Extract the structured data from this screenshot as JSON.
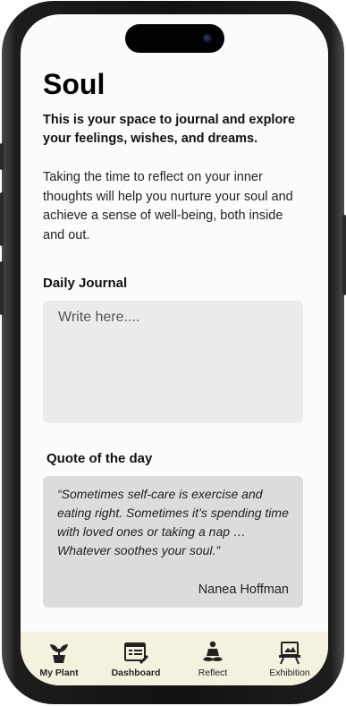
{
  "app": {
    "title": "Soul",
    "intro": "This is your space to journal and explore your feelings, wishes, and dreams.",
    "body": "Taking the time to reflect on your inner thoughts will help you nurture your soul and achieve a sense of well-being, both inside and out."
  },
  "journal": {
    "label": "Daily Journal",
    "placeholder": "Write here...."
  },
  "quote": {
    "label": "Quote of the day",
    "text": "“Sometimes self-care is exercise and eating right. Sometimes it’s spending time with loved ones or taking a nap … Whatever soothes your soul.”",
    "author": "Nanea Hoffman"
  },
  "nav": {
    "items": [
      {
        "label": "My Plant",
        "icon": "plant-icon"
      },
      {
        "label": "Dashboard",
        "icon": "dashboard-icon"
      },
      {
        "label": "Reflect",
        "icon": "meditation-icon"
      },
      {
        "label": "Exhibition",
        "icon": "easel-icon"
      }
    ]
  },
  "colors": {
    "nav_background": "#f4f1df",
    "journal_background": "#ebebeb",
    "quote_background": "#dcdcdc"
  }
}
